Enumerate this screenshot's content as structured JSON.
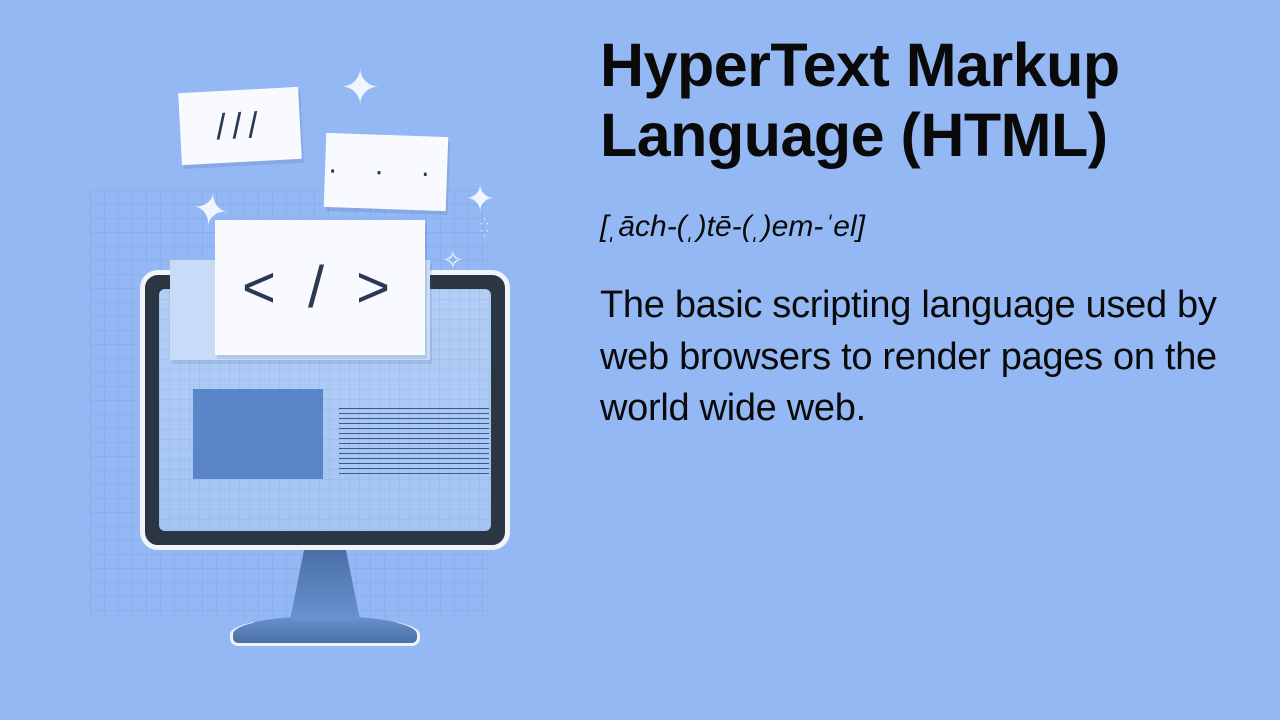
{
  "title": "HyperText Markup Language (HTML)",
  "pronunciation": "[ˌāch-(ˌ)tē-(ˌ)em-ˈel]",
  "definition": "The basic scripting language used by web browsers to render pages on the world wide web.",
  "illustration": {
    "card_main": "< / >",
    "card_slash": "///",
    "card_dots": "· · ·"
  }
}
